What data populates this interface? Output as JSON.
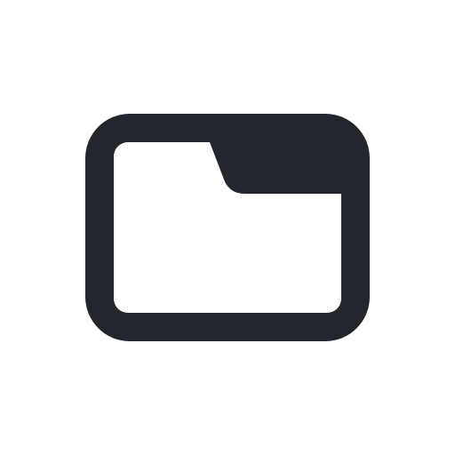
{
  "icon": {
    "name": "folder-icon",
    "color": "#22272e",
    "background": "#ffffff"
  }
}
